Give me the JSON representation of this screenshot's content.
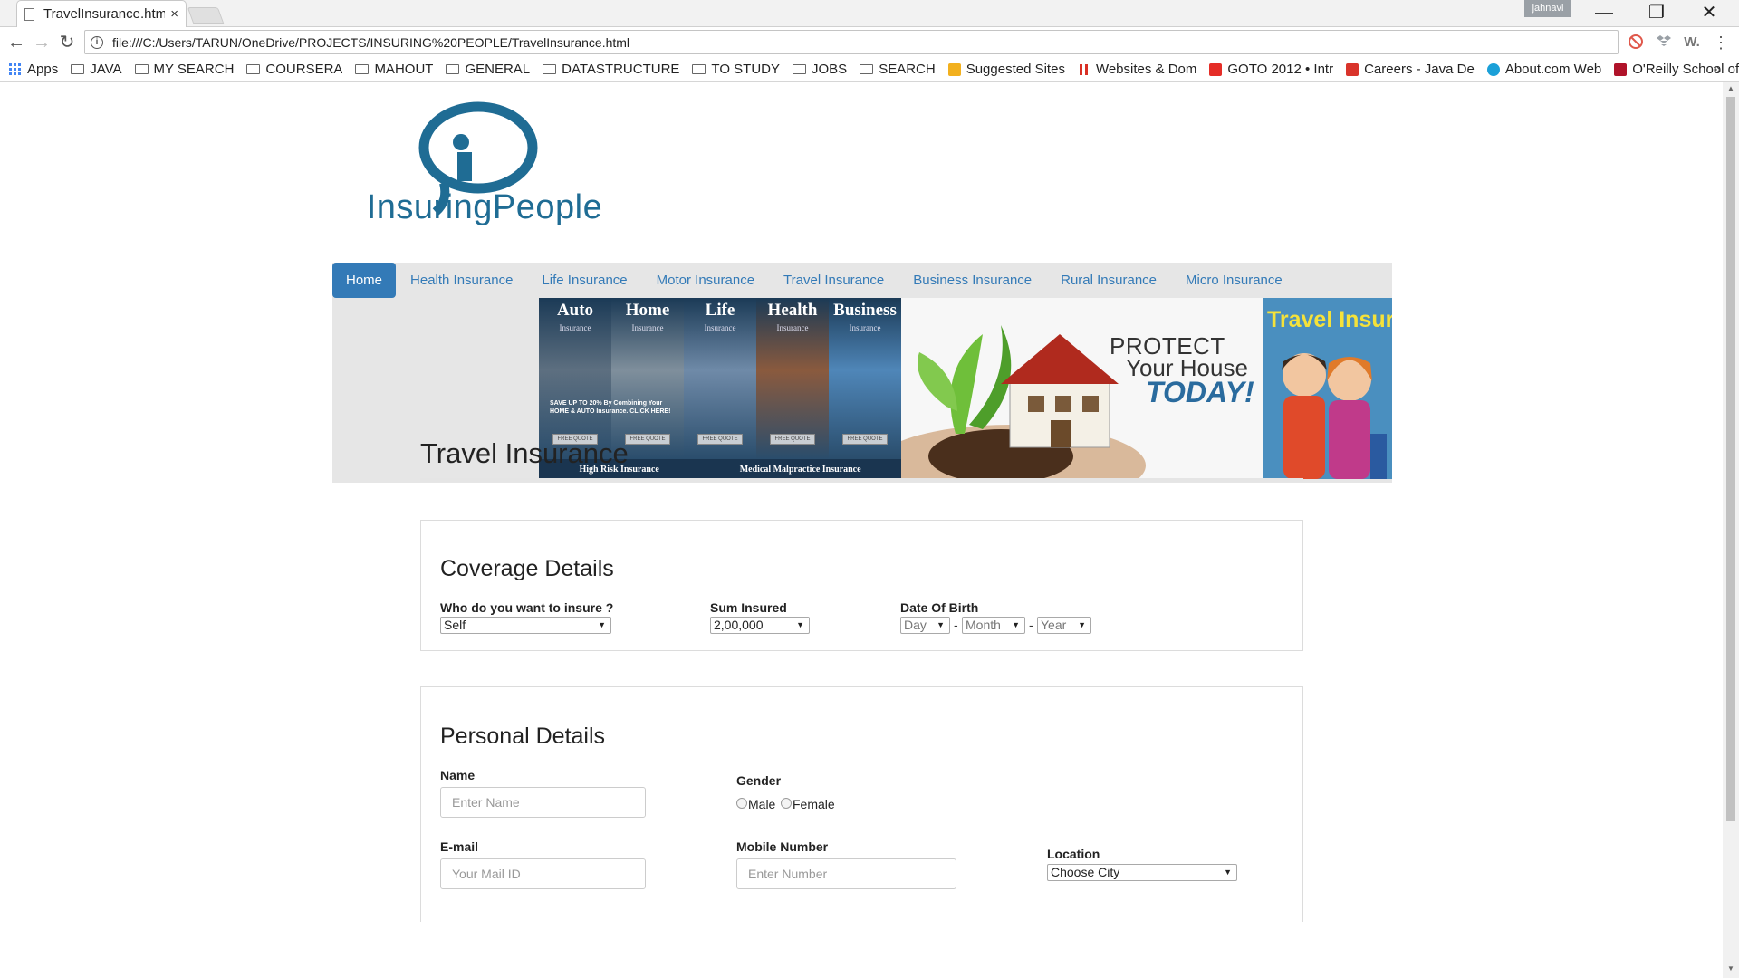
{
  "browser": {
    "tab_title": "TravelInsurance.htm",
    "tab_close": "×",
    "user": "jahnavi",
    "url": "file:///C:/Users/TARUN/OneDrive/PROJECTS/INSURING%20PEOPLE/TravelInsurance.html",
    "win_minimize": "—",
    "win_restore": "❐",
    "win_close": "✕",
    "back": "←",
    "forward": "→",
    "reload": "↻",
    "ext_w": "W.",
    "menu": "⋮",
    "more_bookmarks": "»",
    "bookmarks": [
      {
        "label": "Apps",
        "icon": "apps-icon"
      },
      {
        "label": "JAVA",
        "icon": "folder-icon"
      },
      {
        "label": "MY SEARCH",
        "icon": "folder-icon"
      },
      {
        "label": "COURSERA",
        "icon": "folder-icon"
      },
      {
        "label": "MAHOUT",
        "icon": "folder-icon"
      },
      {
        "label": "GENERAL",
        "icon": "folder-icon"
      },
      {
        "label": "DATASTRUCTURE",
        "icon": "folder-icon"
      },
      {
        "label": "TO STUDY",
        "icon": "folder-icon"
      },
      {
        "label": "JOBS",
        "icon": "folder-icon"
      },
      {
        "label": "SEARCH",
        "icon": "folder-icon"
      },
      {
        "label": "Suggested Sites",
        "icon": "bing-icon"
      },
      {
        "label": "Websites & Dom",
        "icon": "bars-icon"
      },
      {
        "label": "GOTO 2012 • Intr",
        "icon": "youtube-icon"
      },
      {
        "label": "Careers - Java De",
        "icon": "careers-icon"
      },
      {
        "label": "About.com Web",
        "icon": "about-icon"
      },
      {
        "label": "O'Reilly School of",
        "icon": "oreilly-icon"
      }
    ]
  },
  "site": {
    "logo_text": "InsuringPeople",
    "nav": [
      "Home",
      "Health Insurance",
      "Life Insurance",
      "Motor Insurance",
      "Travel Insurance",
      "Business Insurance",
      "Rural Insurance",
      "Micro Insurance"
    ],
    "active_nav": "Home",
    "banner1": {
      "columns": [
        {
          "title": "Auto",
          "sub": "Insurance",
          "btn": "FREE QUOTE"
        },
        {
          "title": "Home",
          "sub": "Insurance",
          "btn": "FREE QUOTE"
        },
        {
          "title": "Life",
          "sub": "Insurance",
          "btn": "FREE QUOTE"
        },
        {
          "title": "Health",
          "sub": "Insurance",
          "btn": "FREE QUOTE"
        },
        {
          "title": "Business",
          "sub": "Insurance",
          "btn": "FREE QUOTE"
        }
      ],
      "promo": "SAVE UP TO 20% By Combining Your HOME & AUTO Insurance. CLICK HERE!",
      "footer_left": "High Risk Insurance",
      "footer_right": "Medical Malpractice Insurance"
    },
    "banner2": {
      "line1": "PROTECT",
      "line2": "Your House",
      "line3": "TODAY!"
    },
    "banner3": {
      "title": "Travel Insuran"
    }
  },
  "page": {
    "title": "Travel Insurance",
    "coverage": {
      "heading": "Coverage Details",
      "who_label": "Who do you want to insure ?",
      "who_value": "Self",
      "sum_label": "Sum Insured",
      "sum_value": "2,00,000",
      "dob_label": "Date Of Birth",
      "day": "Day",
      "month": "Month",
      "year": "Year",
      "sep": "-"
    },
    "personal": {
      "heading": "Personal Details",
      "name_label": "Name",
      "name_placeholder": "Enter Name",
      "gender_label": "Gender",
      "male": "Male",
      "female": "Female",
      "email_label": "E-mail",
      "email_placeholder": "Your Mail ID",
      "mobile_label": "Mobile Number",
      "mobile_placeholder": "Enter Number",
      "location_label": "Location",
      "location_value": "Choose City"
    }
  },
  "colors": {
    "accent": "#337ab7",
    "logo": "#1f6c94",
    "navbar_bg": "#e6e6e6"
  }
}
